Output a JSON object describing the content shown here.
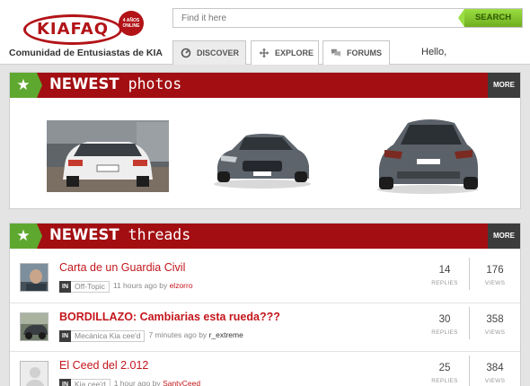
{
  "brand": {
    "logo_text": "KIAFAQ",
    "badge_text": "4 AÑOS ONLINE",
    "tagline": "Comunidad de Entusiastas de KIA",
    "accent_color": "#a20e12",
    "green_color": "#5fa82f"
  },
  "search": {
    "placeholder": "Find it here",
    "button_label": "SEARCH"
  },
  "nav": {
    "tabs": [
      {
        "label": "DISCOVER",
        "icon": "compass-icon",
        "active": true
      },
      {
        "label": "EXPLORE",
        "icon": "move-cross-icon",
        "active": false
      },
      {
        "label": "FORUMS",
        "icon": "chat-bubbles-icon",
        "active": false
      }
    ],
    "greeting": "Hello,"
  },
  "photos_section": {
    "title_bold": "NEWEST",
    "title_rest": " photos",
    "more_label": "MORE",
    "photos": [
      {
        "alt": "white kia sedan rear view",
        "kind": "photo"
      },
      {
        "alt": "grey kia ceed hatchback front",
        "kind": "studio"
      },
      {
        "alt": "grey kia ceed hatchback rear",
        "kind": "studio"
      }
    ]
  },
  "threads_section": {
    "title_bold": "NEWEST",
    "title_rest": " threads",
    "more_label": "MORE",
    "in_label": "IN",
    "replies_label": "REPLIES",
    "views_label": "VIEWS",
    "threads": [
      {
        "title": "Carta de un Guardia Civil",
        "forum": "Off-Topic",
        "time": "11 hours ago by",
        "author": "elzorro",
        "replies": "14",
        "views": "176"
      },
      {
        "title": "BORDILLAZO: Cambiarias esta rueda???",
        "forum": "Mecánica Kia cee'd",
        "time": "7 minutes ago by",
        "author": "r_extreme",
        "replies": "30",
        "views": "358"
      },
      {
        "title": "El Ceed del 2.012",
        "forum": "Kia cee'd",
        "time": "1 hour ago by",
        "author": "SantyCeed",
        "replies": "25",
        "views": "384"
      }
    ]
  }
}
